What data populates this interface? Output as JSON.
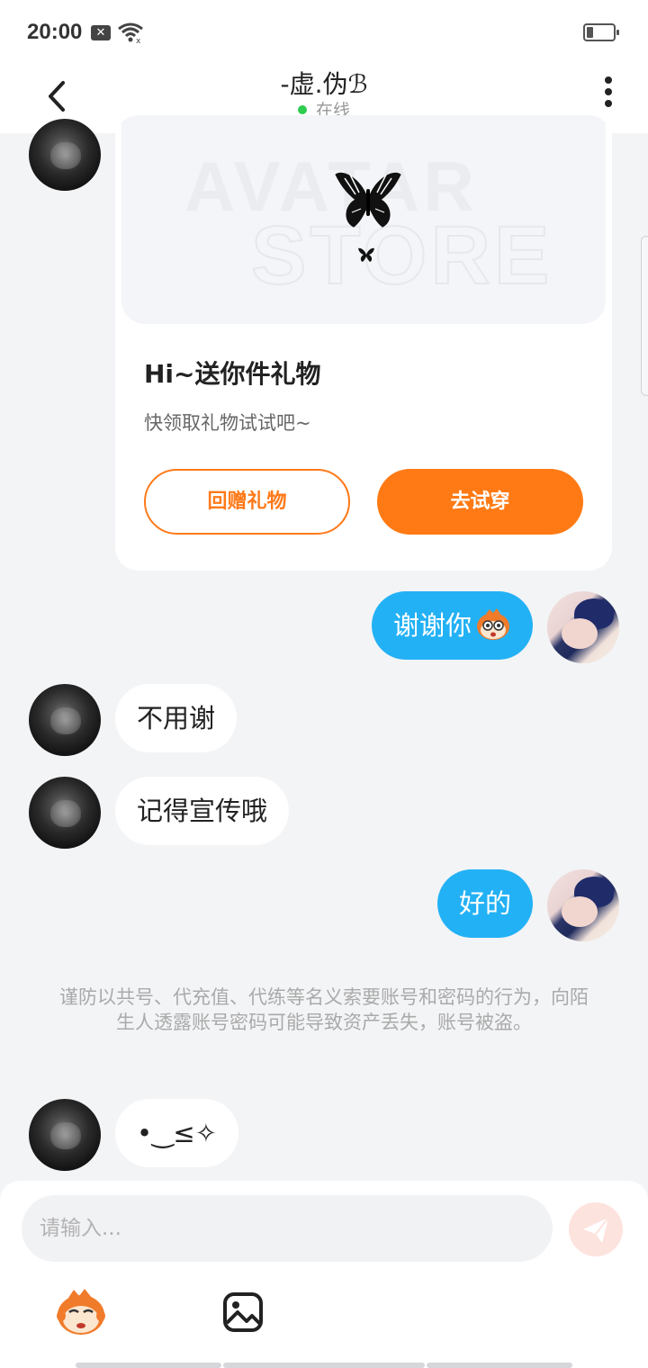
{
  "status_bar": {
    "time": "20:00",
    "notification_icon": "close-box-icon",
    "wifi_icon": "wifi-icon",
    "battery_icon": "battery-low-icon"
  },
  "header": {
    "title": "-虚.伪ℬ",
    "status": "在线",
    "back_icon": "chevron-left-icon",
    "more_icon": "more-vertical-icon",
    "status_color": "#2ecc50"
  },
  "gift_card": {
    "title": "Hi~送你件礼物",
    "subtitle": "快领取礼物试试吧~",
    "return_gift_label": "回赠礼物",
    "try_on_label": "去试穿",
    "accent": "#ff7a14"
  },
  "messages": [
    {
      "side": "self",
      "text": "谢谢你",
      "emoji": "monkey-emoji"
    },
    {
      "side": "other",
      "text": "不用谢"
    },
    {
      "side": "other",
      "text": "记得宣传哦"
    },
    {
      "side": "self",
      "text": "好的"
    },
    {
      "side": "other",
      "text": "•‿≤✧"
    }
  ],
  "notice": "谨防以共号、代充值、代练等名义索要账号和密码的行为，向陌生人透露账号密码可能导致资产丢失，账号被盗。",
  "input": {
    "placeholder": "请输入...",
    "send_icon": "paper-plane-icon",
    "emoji_icon": "monkey-emoji-icon",
    "image_icon": "image-icon"
  },
  "colors": {
    "self_bubble": "#23b1f5",
    "background": "#f3f4f6"
  }
}
